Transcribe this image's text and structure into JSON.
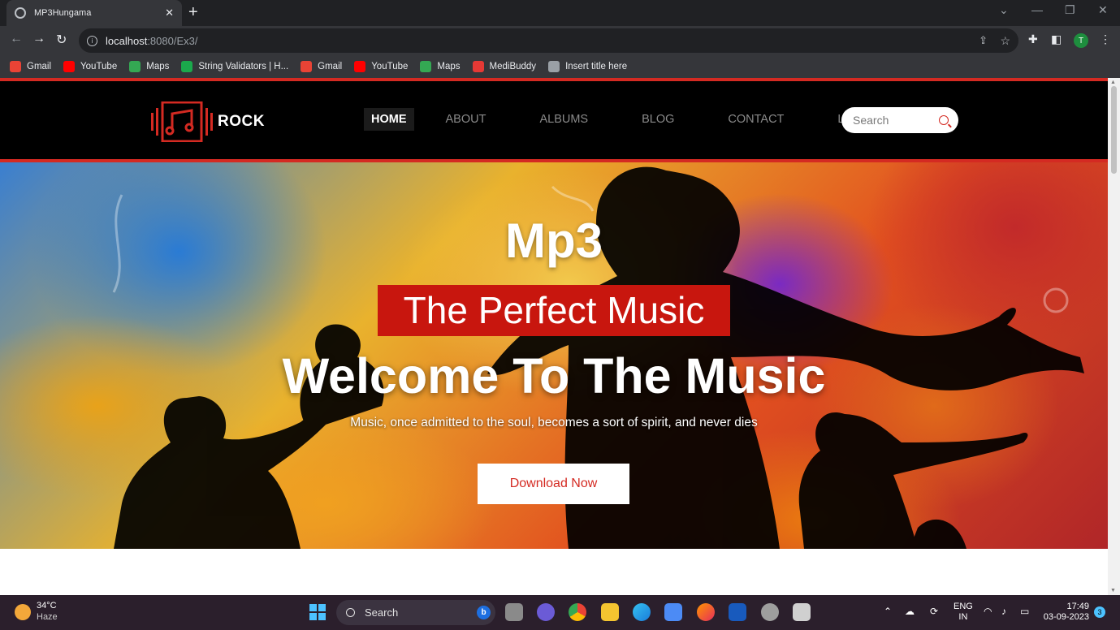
{
  "browser": {
    "tab_title": "MP3Hungama",
    "url_host": "localhost",
    "url_path": ":8080/Ex3/",
    "profile_initial": "T",
    "bookmarks": [
      {
        "label": "Gmail",
        "icon": "gmail-icon",
        "color": "#ea4335"
      },
      {
        "label": "YouTube",
        "icon": "youtube-icon",
        "color": "#ff0000"
      },
      {
        "label": "Maps",
        "icon": "maps-icon",
        "color": "#34a853"
      },
      {
        "label": "String Validators | H...",
        "icon": "hackerrank-icon",
        "color": "#1ba94c"
      },
      {
        "label": "Gmail",
        "icon": "gmail-icon",
        "color": "#ea4335"
      },
      {
        "label": "YouTube",
        "icon": "youtube-icon",
        "color": "#ff0000"
      },
      {
        "label": "Maps",
        "icon": "maps-icon",
        "color": "#34a853"
      },
      {
        "label": "MediBuddy",
        "icon": "medibuddy-icon",
        "color": "#e53935"
      },
      {
        "label": "Insert title here",
        "icon": "globe-icon",
        "color": "#9aa0a6"
      }
    ]
  },
  "site": {
    "logo_text": "ROCK",
    "nav": [
      {
        "label": "HOME",
        "active": true
      },
      {
        "label": "ABOUT",
        "active": false
      },
      {
        "label": "ALBUMS",
        "active": false
      },
      {
        "label": "BLOG",
        "active": false
      },
      {
        "label": "CONTACT",
        "active": false
      },
      {
        "label": "LOGIN",
        "active": false
      }
    ],
    "search_placeholder": "Search",
    "accent_color": "#d42a22"
  },
  "hero": {
    "title": "Mp3",
    "tagline": "The Perfect Music",
    "headline": "Welcome To The Music",
    "quote": "Music, once admitted to the soul, becomes a sort of spirit, and never dies",
    "cta_label": "Download Now"
  },
  "taskbar": {
    "temperature": "34°C",
    "weather": "Haze",
    "search_label": "Search",
    "language": "ENG",
    "region": "IN",
    "time": "17:49",
    "date": "03-09-2023",
    "notification_count": "3"
  }
}
